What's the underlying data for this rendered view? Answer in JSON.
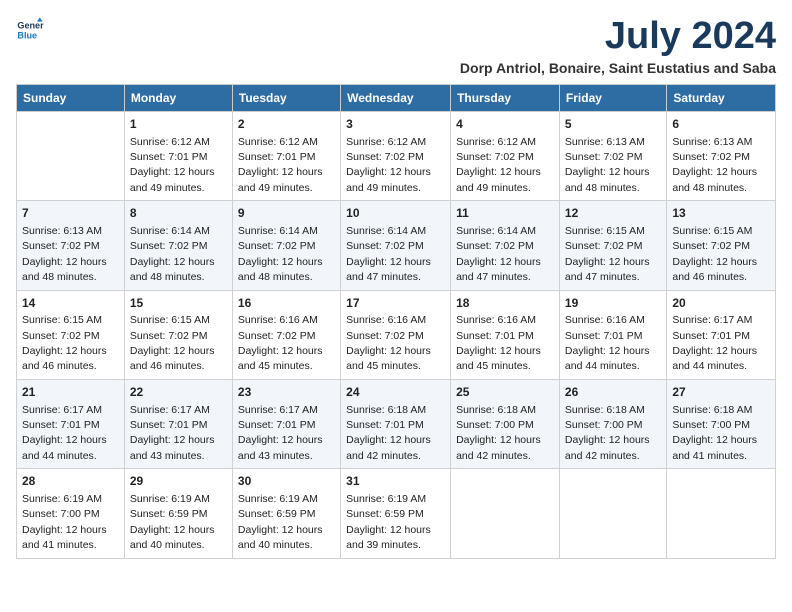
{
  "logo": {
    "line1": "General",
    "line2": "Blue"
  },
  "title": "July 2024",
  "location": "Dorp Antriol, Bonaire, Saint Eustatius and Saba",
  "headers": [
    "Sunday",
    "Monday",
    "Tuesday",
    "Wednesday",
    "Thursday",
    "Friday",
    "Saturday"
  ],
  "weeks": [
    [
      {
        "day": "",
        "sunrise": "",
        "sunset": "",
        "daylight": ""
      },
      {
        "day": "1",
        "sunrise": "Sunrise: 6:12 AM",
        "sunset": "Sunset: 7:01 PM",
        "daylight": "Daylight: 12 hours and 49 minutes."
      },
      {
        "day": "2",
        "sunrise": "Sunrise: 6:12 AM",
        "sunset": "Sunset: 7:01 PM",
        "daylight": "Daylight: 12 hours and 49 minutes."
      },
      {
        "day": "3",
        "sunrise": "Sunrise: 6:12 AM",
        "sunset": "Sunset: 7:02 PM",
        "daylight": "Daylight: 12 hours and 49 minutes."
      },
      {
        "day": "4",
        "sunrise": "Sunrise: 6:12 AM",
        "sunset": "Sunset: 7:02 PM",
        "daylight": "Daylight: 12 hours and 49 minutes."
      },
      {
        "day": "5",
        "sunrise": "Sunrise: 6:13 AM",
        "sunset": "Sunset: 7:02 PM",
        "daylight": "Daylight: 12 hours and 48 minutes."
      },
      {
        "day": "6",
        "sunrise": "Sunrise: 6:13 AM",
        "sunset": "Sunset: 7:02 PM",
        "daylight": "Daylight: 12 hours and 48 minutes."
      }
    ],
    [
      {
        "day": "7",
        "sunrise": "Sunrise: 6:13 AM",
        "sunset": "Sunset: 7:02 PM",
        "daylight": "Daylight: 12 hours and 48 minutes."
      },
      {
        "day": "8",
        "sunrise": "Sunrise: 6:14 AM",
        "sunset": "Sunset: 7:02 PM",
        "daylight": "Daylight: 12 hours and 48 minutes."
      },
      {
        "day": "9",
        "sunrise": "Sunrise: 6:14 AM",
        "sunset": "Sunset: 7:02 PM",
        "daylight": "Daylight: 12 hours and 48 minutes."
      },
      {
        "day": "10",
        "sunrise": "Sunrise: 6:14 AM",
        "sunset": "Sunset: 7:02 PM",
        "daylight": "Daylight: 12 hours and 47 minutes."
      },
      {
        "day": "11",
        "sunrise": "Sunrise: 6:14 AM",
        "sunset": "Sunset: 7:02 PM",
        "daylight": "Daylight: 12 hours and 47 minutes."
      },
      {
        "day": "12",
        "sunrise": "Sunrise: 6:15 AM",
        "sunset": "Sunset: 7:02 PM",
        "daylight": "Daylight: 12 hours and 47 minutes."
      },
      {
        "day": "13",
        "sunrise": "Sunrise: 6:15 AM",
        "sunset": "Sunset: 7:02 PM",
        "daylight": "Daylight: 12 hours and 46 minutes."
      }
    ],
    [
      {
        "day": "14",
        "sunrise": "Sunrise: 6:15 AM",
        "sunset": "Sunset: 7:02 PM",
        "daylight": "Daylight: 12 hours and 46 minutes."
      },
      {
        "day": "15",
        "sunrise": "Sunrise: 6:15 AM",
        "sunset": "Sunset: 7:02 PM",
        "daylight": "Daylight: 12 hours and 46 minutes."
      },
      {
        "day": "16",
        "sunrise": "Sunrise: 6:16 AM",
        "sunset": "Sunset: 7:02 PM",
        "daylight": "Daylight: 12 hours and 45 minutes."
      },
      {
        "day": "17",
        "sunrise": "Sunrise: 6:16 AM",
        "sunset": "Sunset: 7:02 PM",
        "daylight": "Daylight: 12 hours and 45 minutes."
      },
      {
        "day": "18",
        "sunrise": "Sunrise: 6:16 AM",
        "sunset": "Sunset: 7:01 PM",
        "daylight": "Daylight: 12 hours and 45 minutes."
      },
      {
        "day": "19",
        "sunrise": "Sunrise: 6:16 AM",
        "sunset": "Sunset: 7:01 PM",
        "daylight": "Daylight: 12 hours and 44 minutes."
      },
      {
        "day": "20",
        "sunrise": "Sunrise: 6:17 AM",
        "sunset": "Sunset: 7:01 PM",
        "daylight": "Daylight: 12 hours and 44 minutes."
      }
    ],
    [
      {
        "day": "21",
        "sunrise": "Sunrise: 6:17 AM",
        "sunset": "Sunset: 7:01 PM",
        "daylight": "Daylight: 12 hours and 44 minutes."
      },
      {
        "day": "22",
        "sunrise": "Sunrise: 6:17 AM",
        "sunset": "Sunset: 7:01 PM",
        "daylight": "Daylight: 12 hours and 43 minutes."
      },
      {
        "day": "23",
        "sunrise": "Sunrise: 6:17 AM",
        "sunset": "Sunset: 7:01 PM",
        "daylight": "Daylight: 12 hours and 43 minutes."
      },
      {
        "day": "24",
        "sunrise": "Sunrise: 6:18 AM",
        "sunset": "Sunset: 7:01 PM",
        "daylight": "Daylight: 12 hours and 42 minutes."
      },
      {
        "day": "25",
        "sunrise": "Sunrise: 6:18 AM",
        "sunset": "Sunset: 7:00 PM",
        "daylight": "Daylight: 12 hours and 42 minutes."
      },
      {
        "day": "26",
        "sunrise": "Sunrise: 6:18 AM",
        "sunset": "Sunset: 7:00 PM",
        "daylight": "Daylight: 12 hours and 42 minutes."
      },
      {
        "day": "27",
        "sunrise": "Sunrise: 6:18 AM",
        "sunset": "Sunset: 7:00 PM",
        "daylight": "Daylight: 12 hours and 41 minutes."
      }
    ],
    [
      {
        "day": "28",
        "sunrise": "Sunrise: 6:19 AM",
        "sunset": "Sunset: 7:00 PM",
        "daylight": "Daylight: 12 hours and 41 minutes."
      },
      {
        "day": "29",
        "sunrise": "Sunrise: 6:19 AM",
        "sunset": "Sunset: 6:59 PM",
        "daylight": "Daylight: 12 hours and 40 minutes."
      },
      {
        "day": "30",
        "sunrise": "Sunrise: 6:19 AM",
        "sunset": "Sunset: 6:59 PM",
        "daylight": "Daylight: 12 hours and 40 minutes."
      },
      {
        "day": "31",
        "sunrise": "Sunrise: 6:19 AM",
        "sunset": "Sunset: 6:59 PM",
        "daylight": "Daylight: 12 hours and 39 minutes."
      },
      {
        "day": "",
        "sunrise": "",
        "sunset": "",
        "daylight": ""
      },
      {
        "day": "",
        "sunrise": "",
        "sunset": "",
        "daylight": ""
      },
      {
        "day": "",
        "sunrise": "",
        "sunset": "",
        "daylight": ""
      }
    ]
  ]
}
